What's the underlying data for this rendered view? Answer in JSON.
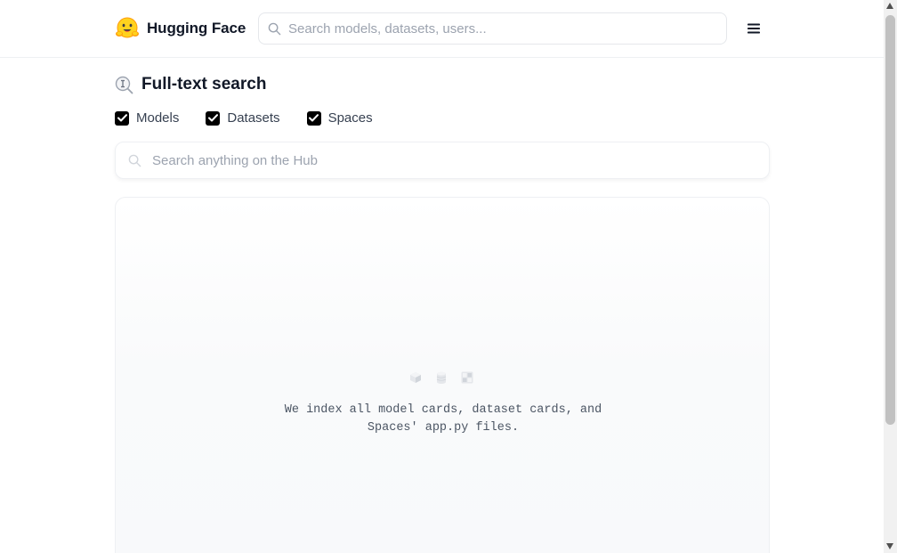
{
  "header": {
    "brand": "Hugging Face",
    "search_placeholder": "Search models, datasets, users...",
    "menu_icon": "hamburger-menu-icon"
  },
  "page": {
    "title": "Full-text search",
    "title_icon": "full-text-search-icon"
  },
  "filters": [
    {
      "label": "Models",
      "checked": true
    },
    {
      "label": "Datasets",
      "checked": true
    },
    {
      "label": "Spaces",
      "checked": true
    }
  ],
  "search": {
    "placeholder": "Search anything on the Hub",
    "value": ""
  },
  "empty_state": {
    "icons": [
      "model-cube-icon",
      "dataset-cylinder-icon",
      "space-grid-icon"
    ],
    "line1": "We index all model cards, dataset cards, and",
    "line2": "Spaces' app.py files."
  },
  "colors": {
    "accent": "#000000",
    "border": "#e5e7eb",
    "muted_text": "#9ca3af"
  }
}
